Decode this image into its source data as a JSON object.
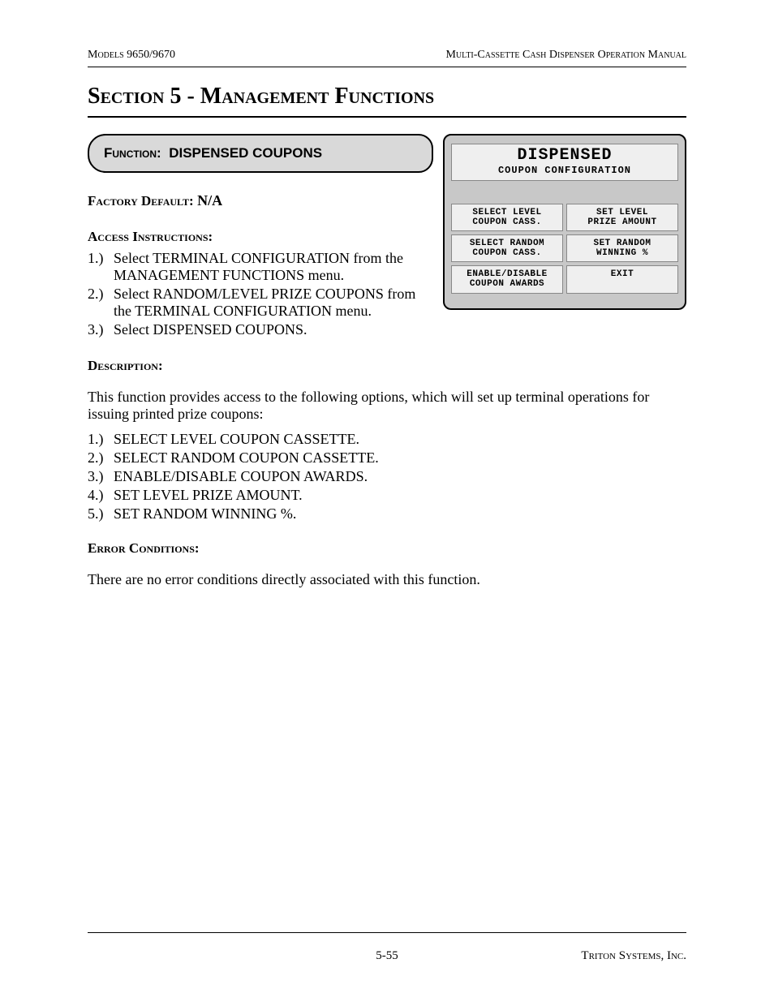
{
  "header": {
    "left": "Models 9650/9670",
    "right": "Multi-Cassette Cash Dispenser Operation Manual"
  },
  "section_title": "Section 5 - Management Functions",
  "function_box": {
    "label": "Function:",
    "value": "DISPENSED COUPONS"
  },
  "screen": {
    "title": "DISPENSED",
    "subtitle": "COUPON CONFIGURATION",
    "buttons": [
      "SELECT LEVEL\nCOUPON CASS.",
      "SET LEVEL\nPRIZE AMOUNT",
      "SELECT RANDOM\nCOUPON CASS.",
      "SET RANDOM\nWINNING %",
      "ENABLE/DISABLE\nCOUPON AWARDS",
      "EXIT"
    ]
  },
  "factory_default": {
    "label": "Factory Default:",
    "value": "N/A"
  },
  "access_instructions": {
    "label": "Access Instructions:",
    "items": [
      "Select TERMINAL CONFIGURATION from the MANAGEMENT FUNCTIONS menu.",
      "Select RANDOM/LEVEL PRIZE COUPONS from the TERMINAL CONFIGURATION menu.",
      "Select DISPENSED COUPONS."
    ]
  },
  "description": {
    "label": "Description:",
    "paragraph": "This function provides access to the following options, which will set up terminal operations for issuing printed prize coupons:",
    "items": [
      "SELECT LEVEL COUPON CASSETTE.",
      "SELECT RANDOM COUPON CASSETTE.",
      "ENABLE/DISABLE COUPON AWARDS.",
      "SET LEVEL PRIZE AMOUNT.",
      "SET RANDOM WINNING %."
    ]
  },
  "error_conditions": {
    "label": "Error Conditions:",
    "paragraph": "There are no error conditions directly associated with this function."
  },
  "footer": {
    "page": "5-55",
    "company": "Triton Systems, Inc."
  }
}
